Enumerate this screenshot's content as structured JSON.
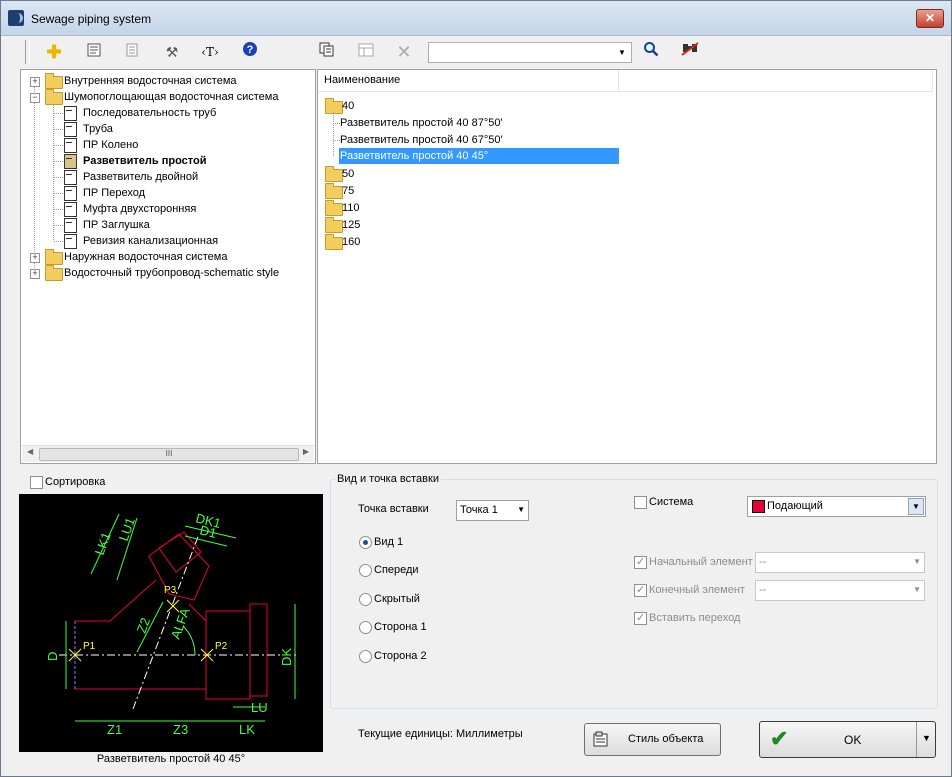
{
  "window": {
    "title": "Sewage piping system"
  },
  "toolbar": {
    "icons": [
      "add-icon",
      "properties-icon",
      "list-icon",
      "tools-icon",
      "text-style-icon",
      "help-icon",
      "copy-icon",
      "table-icon",
      "delete-icon",
      "search-icon",
      "filter-icon"
    ],
    "search_value": ""
  },
  "tree": {
    "items": [
      {
        "label": "Внутренняя водосточная система",
        "level": 0,
        "expanded": false,
        "type": "folder"
      },
      {
        "label": "Шумопоглощающая водосточная система",
        "level": 0,
        "expanded": true,
        "type": "folder"
      },
      {
        "label": "Последовательность труб",
        "level": 1,
        "type": "doc"
      },
      {
        "label": "Труба",
        "level": 1,
        "type": "doc"
      },
      {
        "label": "ПР Колено",
        "level": 1,
        "type": "doc"
      },
      {
        "label": "Разветвитель простой",
        "level": 1,
        "type": "doc",
        "bold": true
      },
      {
        "label": "Разветвитель двойной",
        "level": 1,
        "type": "doc"
      },
      {
        "label": "ПР Переход",
        "level": 1,
        "type": "doc"
      },
      {
        "label": "Муфта двухсторонняя",
        "level": 1,
        "type": "doc"
      },
      {
        "label": "ПР Заглушка",
        "level": 1,
        "type": "doc"
      },
      {
        "label": "Ревизия канализационная",
        "level": 1,
        "type": "doc"
      },
      {
        "label": "Наружная водосточная система",
        "level": 0,
        "expanded": false,
        "type": "folder"
      },
      {
        "label": "Водосточный трубопровод-schematic style",
        "level": 0,
        "expanded": false,
        "type": "folder"
      }
    ],
    "scroll_thumb": "III"
  },
  "list": {
    "column_header": "Наименование",
    "rows": [
      {
        "label": "40",
        "type": "folder"
      },
      {
        "label": "Разветвитель простой 40 87°50'",
        "type": "item"
      },
      {
        "label": "Разветвитель простой 40 67°50'",
        "type": "item"
      },
      {
        "label": "Разветвитель простой 40 45°",
        "type": "item",
        "selected": true
      },
      {
        "label": "50",
        "type": "folder"
      },
      {
        "label": "75",
        "type": "folder"
      },
      {
        "label": "110",
        "type": "folder"
      },
      {
        "label": "125",
        "type": "folder"
      },
      {
        "label": "160",
        "type": "folder"
      }
    ]
  },
  "sort": {
    "label": "Сортировка",
    "checked": false
  },
  "preview": {
    "caption": "Разветвитель простой 40 45°",
    "labels": {
      "dk1": "DK1",
      "d1": "D1",
      "lk1": "LK1",
      "lu1": "LU1",
      "p3": "P3",
      "z2": "Z2",
      "alfa": "ALFA",
      "p1": "P1",
      "p2": "P2",
      "d": "D",
      "dk": "DK",
      "lu": "LU",
      "z1": "Z1",
      "z3": "Z3",
      "lk": "LK"
    }
  },
  "insert_group": {
    "title": "Вид и точка вставки",
    "insert_point_label": "Точка вставки",
    "insert_point_value": "Точка 1",
    "views": [
      "Вид 1",
      "Спереди",
      "Скрытый",
      "Сторона 1",
      "Сторона 2"
    ],
    "selected_view": "Вид 1",
    "system_label": "Система",
    "system_value": "Подающий",
    "system_color": "#e8003a",
    "start_element_label": "Начальный элемент",
    "start_element_value": "--",
    "end_element_label": "Конечный элемент",
    "end_element_value": "--",
    "insert_transition_label": "Вставить переход"
  },
  "footer": {
    "units_text": "Текущие единицы: Миллиметры",
    "style_button": "Стиль объекта",
    "ok_button": "OK"
  }
}
